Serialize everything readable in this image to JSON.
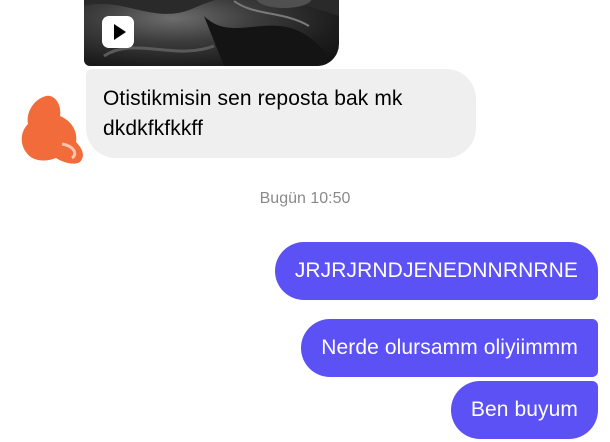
{
  "conversation": {
    "media": {
      "type": "video",
      "badge_icon": "play-icon"
    },
    "incoming_message": {
      "text_line1": "Otistikmisin sen reposta bak mk",
      "text_line2": "dkdkfkfkkff",
      "bubble_color": "#efefef"
    },
    "timestamp": "Bugün 10:50",
    "outgoing_messages": [
      {
        "text": "JRJRJRNDJENEDNNRNRNE"
      },
      {
        "text": "Nerde olursamm oliyiimmm"
      },
      {
        "text": "Ben buyum"
      }
    ],
    "colors": {
      "outgoing_bubble": "#5b51f5",
      "avatar_scribble": "#f26b3a",
      "timestamp_text": "#8a8a8a"
    }
  }
}
